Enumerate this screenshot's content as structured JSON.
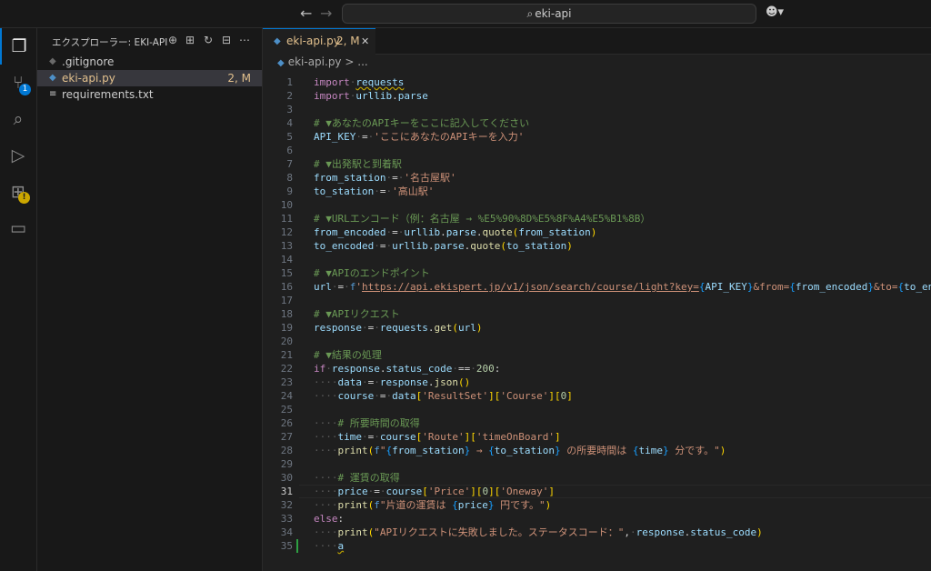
{
  "titlebar": {
    "search_text": "eki-api"
  },
  "activity": {
    "scm_badge": "1"
  },
  "sidebar": {
    "title": "エクスプローラー: EKI-API",
    "files": [
      {
        "name": ".gitignore",
        "status": ""
      },
      {
        "name": "eki-api.py",
        "status": "2, M"
      },
      {
        "name": "requirements.txt",
        "status": ""
      }
    ]
  },
  "tab": {
    "name": "eki-api.py",
    "status": "2, M"
  },
  "breadcrumb": {
    "file": "eki-api.py",
    "sep": ">",
    "more": "..."
  },
  "editor": {
    "current_line": 31,
    "lines": [
      "import requests",
      "import urllib.parse",
      "",
      "# ▼あなたのAPIキーをここに記入してください",
      "API_KEY = 'ここにあなたのAPIキーを入力'",
      "",
      "# ▼出発駅と到着駅",
      "from_station = '名古屋駅'",
      "to_station = '高山駅'",
      "",
      "# ▼URLエンコード（例：名古屋 → %E5%90%8D%E5%8F%A4%E5%B1%8B）",
      "from_encoded = urllib.parse.quote(from_station)",
      "to_encoded = urllib.parse.quote(to_station)",
      "",
      "# ▼APIのエンドポイント",
      "url = f'https://api.ekispert.jp/v1/json/search/course/light?key={API_KEY}&from={from_encoded}&to={to_encoded}'",
      "",
      "# ▼APIリクエスト",
      "response = requests.get(url)",
      "",
      "# ▼結果の処理",
      "if response.status_code == 200:",
      "    data = response.json()",
      "    course = data['ResultSet']['Course'][0]",
      "",
      "    # 所要時間の取得",
      "    time = course['Route']['timeOnBoard']",
      "    print(f\"{from_station} → {to_station} の所要時間は {time} 分です。\")",
      "",
      "    # 運賃の取得",
      "    price = course['Price'][0]['Oneway']",
      "    print(f\"片道の運賃は {price} 円です。\")",
      "else:",
      "    print(\"APIリクエストに失敗しました。ステータスコード：\", response.status_code)",
      "    a"
    ]
  }
}
